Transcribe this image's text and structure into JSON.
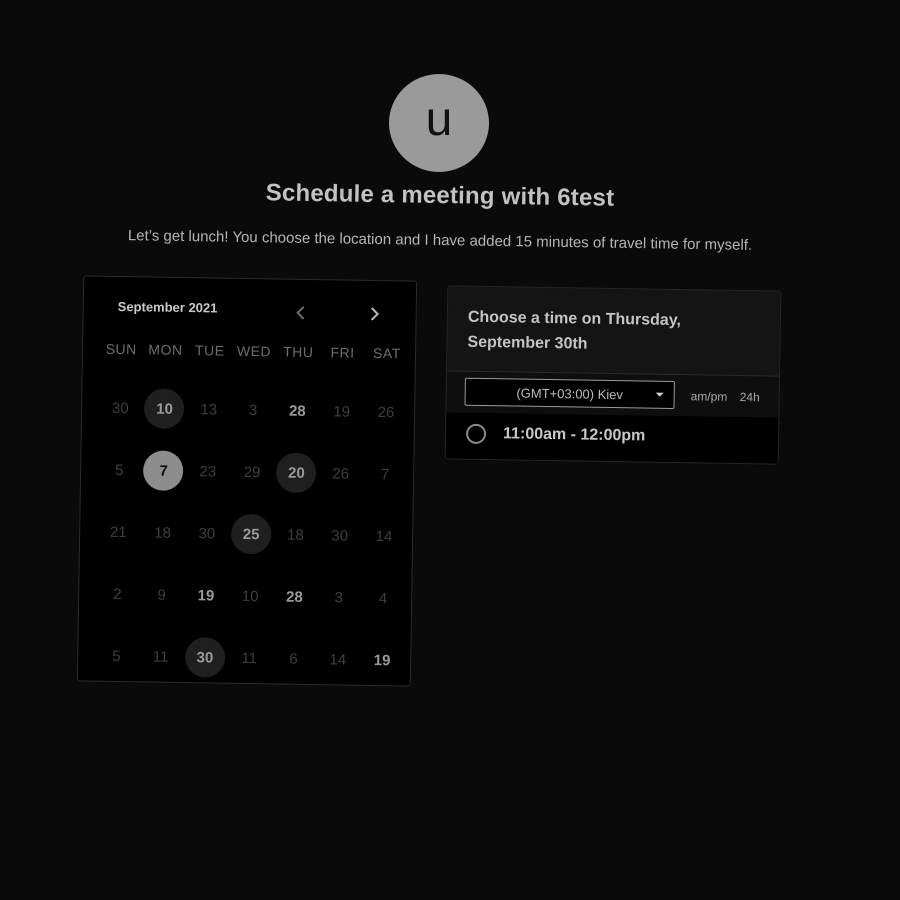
{
  "host": {
    "avatar_initial": "u",
    "title": "Schedule a meeting with 6test",
    "description": "Let’s get lunch! You choose the location and I have added 15 minutes of travel time for myself."
  },
  "calendar": {
    "month_label": "September 2021",
    "prev_icon": "chevron-left-icon",
    "next_icon": "chevron-right-icon",
    "weekdays": [
      "SUN",
      "MON",
      "TUE",
      "WED",
      "THU",
      "FRI",
      "SAT"
    ],
    "weeks": [
      [
        {
          "label": "30",
          "state": "disabled"
        },
        {
          "label": "10",
          "state": "highlighted"
        },
        {
          "label": "13",
          "state": "disabled"
        },
        {
          "label": "3",
          "state": "disabled"
        },
        {
          "label": "28",
          "state": "available"
        },
        {
          "label": "19",
          "state": "disabled"
        },
        {
          "label": "26",
          "state": "disabled"
        }
      ],
      [
        {
          "label": "5",
          "state": "disabled"
        },
        {
          "label": "7",
          "state": "selected"
        },
        {
          "label": "23",
          "state": "disabled"
        },
        {
          "label": "29",
          "state": "disabled"
        },
        {
          "label": "20",
          "state": "highlighted"
        },
        {
          "label": "26",
          "state": "disabled"
        },
        {
          "label": "7",
          "state": "disabled"
        }
      ],
      [
        {
          "label": "21",
          "state": "disabled"
        },
        {
          "label": "18",
          "state": "disabled"
        },
        {
          "label": "30",
          "state": "disabled"
        },
        {
          "label": "25",
          "state": "highlighted"
        },
        {
          "label": "18",
          "state": "disabled"
        },
        {
          "label": "30",
          "state": "disabled"
        },
        {
          "label": "14",
          "state": "disabled"
        }
      ],
      [
        {
          "label": "2",
          "state": "disabled"
        },
        {
          "label": "9",
          "state": "disabled"
        },
        {
          "label": "19",
          "state": "available"
        },
        {
          "label": "10",
          "state": "disabled"
        },
        {
          "label": "28",
          "state": "available"
        },
        {
          "label": "3",
          "state": "disabled"
        },
        {
          "label": "4",
          "state": "disabled"
        }
      ],
      [
        {
          "label": "5",
          "state": "disabled"
        },
        {
          "label": "11",
          "state": "disabled"
        },
        {
          "label": "30",
          "state": "highlighted"
        },
        {
          "label": "11",
          "state": "disabled"
        },
        {
          "label": "6",
          "state": "disabled"
        },
        {
          "label": "14",
          "state": "disabled"
        },
        {
          "label": "19",
          "state": "available"
        }
      ]
    ]
  },
  "time_panel": {
    "heading": "Choose a time on Thursday, September 30th",
    "timezone": "(GMT+03:00) Kiev",
    "format_ampm": "am/pm",
    "format_24h": "24h",
    "slots": [
      {
        "label": "11:00am - 12:00pm"
      }
    ]
  },
  "colors": {
    "background": "#0a0a0a",
    "selected_day": "#8d8d8d",
    "highlighted_day": "#1f1f1f"
  }
}
